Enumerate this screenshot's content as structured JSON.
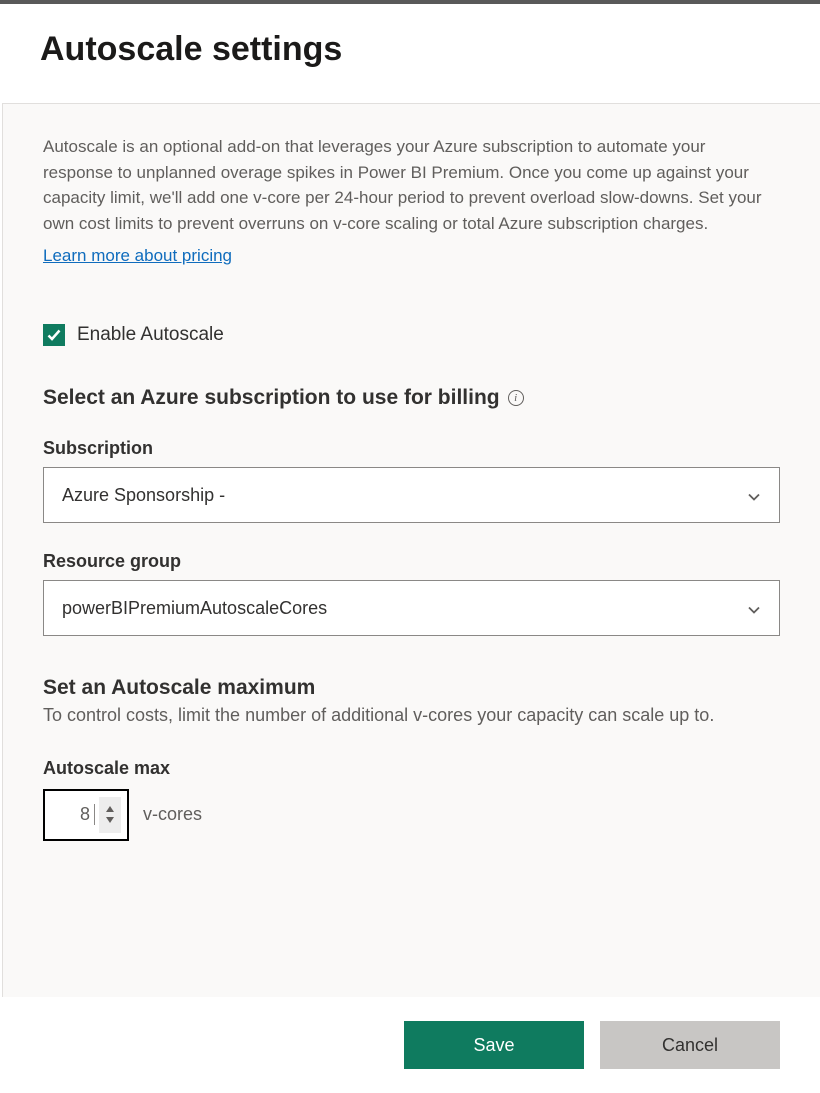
{
  "header": {
    "title": "Autoscale settings"
  },
  "intro": {
    "description": "Autoscale is an optional add-on that leverages your Azure subscription to automate your response to unplanned overage spikes in Power BI Premium. Once you come up against your capacity limit, we'll add one v-core per 24-hour period to prevent overload slow-downs. Set your own cost limits to prevent overruns on v-core scaling or total Azure subscription charges.",
    "learn_more_label": "Learn more about pricing"
  },
  "enable": {
    "label": "Enable Autoscale",
    "checked": true
  },
  "billing": {
    "heading": "Select an Azure subscription to use for billing",
    "subscription_label": "Subscription",
    "subscription_value": "Azure Sponsorship -",
    "resource_group_label": "Resource group",
    "resource_group_value": "powerBIPremiumAutoscaleCores"
  },
  "maximum": {
    "heading": "Set an Autoscale maximum",
    "description": "To control costs, limit the number of additional v-cores your capacity can scale up to.",
    "field_label": "Autoscale max",
    "value": "8",
    "unit": "v-cores"
  },
  "buttons": {
    "save": "Save",
    "cancel": "Cancel"
  }
}
